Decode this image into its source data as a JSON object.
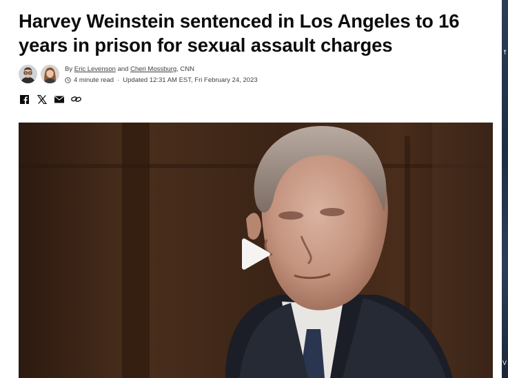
{
  "article": {
    "headline": "Harvey Weinstein sentenced in Los Angeles to 16 years in prison for sexual assault charges",
    "byline": {
      "prefix": "By",
      "author1": "Eric Levenson",
      "connector": "and",
      "author2": "Cheri Mossburg",
      "outlet": ", CNN"
    },
    "read_time": "4 minute read",
    "separator": "·",
    "updated": "Updated 12:31 AM EST, Fri February 24, 2023"
  },
  "share_icons": [
    "facebook-icon",
    "x-icon",
    "email-icon",
    "link-icon"
  ],
  "media": {
    "type": "video",
    "play_icon": "play-icon"
  },
  "right_edge": {
    "arrow": "↑",
    "corner_text": "V"
  },
  "colors": {
    "headline": "#0c0c0c",
    "meta_text": "#404040",
    "photo_background": "#3a2418",
    "play_button": "#ffffff"
  }
}
